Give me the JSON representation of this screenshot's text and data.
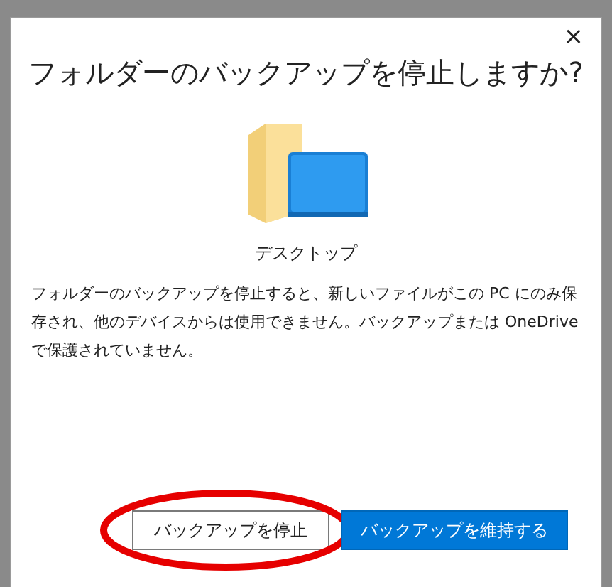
{
  "dialog": {
    "close": "×",
    "title": "フォルダーのバックアップを停止しますか?",
    "folder_label": "デスクトップ",
    "message": "フォルダーのバックアップを停止すると、新しいファイルがこの PC にのみ保存され、他のデバイスからは使用できません。バックアップまたは OneDrive で保護されていません。",
    "buttons": [
      {
        "label": "バックアップを停止",
        "kind": "secondary",
        "circled": true
      },
      {
        "label": "バックアップを維持する",
        "kind": "primary",
        "circled": false
      }
    ]
  }
}
